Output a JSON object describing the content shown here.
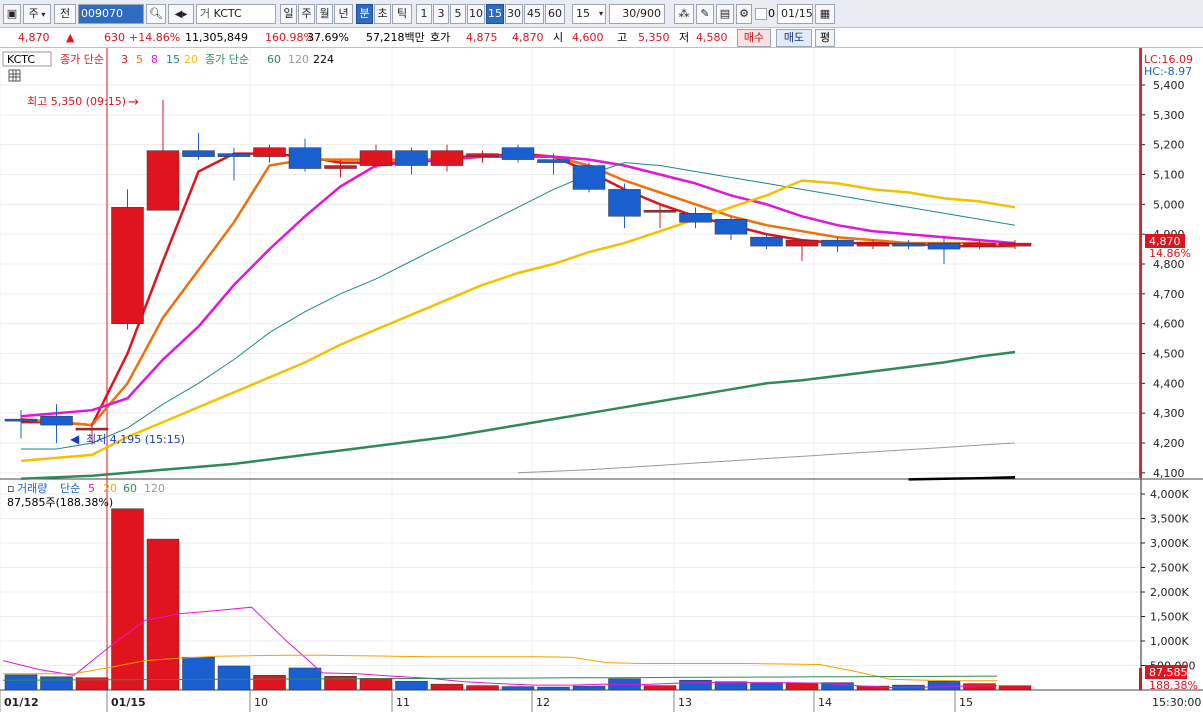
{
  "toolbar": {
    "market_label": "주",
    "all_label": "전",
    "stock_code": "009070",
    "stock_name": "KCTC",
    "period_day": "일",
    "period_week": "주",
    "period_month": "월",
    "period_year": "년",
    "period_minute": "분",
    "period_second": "초",
    "period_tick": "틱",
    "intervals": [
      "1",
      "3",
      "5",
      "10",
      "15",
      "30",
      "45",
      "60"
    ],
    "selected_interval": "15",
    "interval_select_value": "15",
    "count_display": "30/900",
    "checkbox_value": "0",
    "date_value": "01/15"
  },
  "quote": {
    "price": "4,870",
    "arrow": "▲",
    "change": "630",
    "change_pct": "+14.86%",
    "volume": "11,305,849",
    "volume_ratio": "160.98%",
    "turnover": "37.69%",
    "trade_value": "57,218백만",
    "ask_label": "호가",
    "ask_price": "4,875",
    "bid_price": "4,870",
    "open_label": "시",
    "open_value": "4,600",
    "high_label": "고",
    "high_value": "5,350",
    "low_label": "저",
    "low_value": "4,580",
    "buy_label": "매수",
    "sell_label": "매도",
    "avg_label": "평"
  },
  "colors": {
    "up": "#e0141e",
    "down": "#1a5fcf",
    "ma3": "#e0141e",
    "ma5": "#f06f0a",
    "ma8": "#e614d8",
    "ma15": "#1a8a8a",
    "ma20": "#f5c000",
    "ma60": "#2e8b57",
    "ma120": "#999999",
    "ma224": "#000000"
  },
  "price_panel": {
    "symbol": "KCTC",
    "legend_group1_label": "종가 단순",
    "legend_group1_periods": [
      "3",
      "5",
      "8",
      "15",
      "20"
    ],
    "legend_group2_label": "종가 단순",
    "legend_group2_periods": [
      "60",
      "120",
      "224"
    ],
    "lc_label": "LC:16.09",
    "hc_label": "HC:-8.97",
    "high_annotation": "최고 5,350 (09:15)",
    "low_annotation": "최저 4,195 (15:15)",
    "current_price_tag": "4,870",
    "current_pct_tag": "14.86%",
    "y_ticks": [
      "5,400",
      "5,300",
      "5,200",
      "5,100",
      "5,000",
      "4,900",
      "4,800",
      "4,700",
      "4,600",
      "4,500",
      "4,400",
      "4,300",
      "4,200",
      "4,100"
    ]
  },
  "volume_panel": {
    "legend_label": "거래량",
    "legend_ma_label": "단순",
    "legend_periods": [
      "5",
      "20",
      "60",
      "120"
    ],
    "current_volume": "87,585주(188.38%)",
    "y_ticks": [
      "4,000K",
      "3,500K",
      "3,000K",
      "2,500K",
      "2,000K",
      "1,500K",
      "1,000K",
      "500,000"
    ],
    "current_tag": "87,585",
    "current_pct_tag": "188.38%"
  },
  "x_axis": {
    "labels": [
      "01/12",
      "01/15",
      "10",
      "11",
      "12",
      "13",
      "14",
      "15"
    ],
    "time_label": "15:30:00"
  },
  "chart_data": {
    "type": "candlestick",
    "interval": "15분",
    "candles": [
      {
        "o": 4280,
        "h": 4310,
        "l": 4215,
        "c": 4275
      },
      {
        "o": 4290,
        "h": 4330,
        "l": 4200,
        "c": 4260
      },
      {
        "o": 4250,
        "h": 4270,
        "l": 4195,
        "c": 4250
      },
      {
        "o": 4600,
        "h": 5050,
        "l": 4580,
        "c": 4990
      },
      {
        "o": 4980,
        "h": 5350,
        "l": 4980,
        "c": 5180
      },
      {
        "o": 5180,
        "h": 5240,
        "l": 5150,
        "c": 5160
      },
      {
        "o": 5170,
        "h": 5190,
        "l": 5080,
        "c": 5160
      },
      {
        "o": 5160,
        "h": 5200,
        "l": 5140,
        "c": 5190
      },
      {
        "o": 5190,
        "h": 5220,
        "l": 5110,
        "c": 5120
      },
      {
        "o": 5120,
        "h": 5150,
        "l": 5090,
        "c": 5130
      },
      {
        "o": 5130,
        "h": 5200,
        "l": 5120,
        "c": 5180
      },
      {
        "o": 5180,
        "h": 5190,
        "l": 5100,
        "c": 5130
      },
      {
        "o": 5130,
        "h": 5200,
        "l": 5110,
        "c": 5180
      },
      {
        "o": 5160,
        "h": 5180,
        "l": 5140,
        "c": 5170
      },
      {
        "o": 5190,
        "h": 5200,
        "l": 5140,
        "c": 5150
      },
      {
        "o": 5150,
        "h": 5170,
        "l": 5100,
        "c": 5140
      },
      {
        "o": 5130,
        "h": 5140,
        "l": 5040,
        "c": 5050
      },
      {
        "o": 5050,
        "h": 5070,
        "l": 4920,
        "c": 4960
      },
      {
        "o": 4980,
        "h": 5000,
        "l": 4920,
        "c": 4980
      },
      {
        "o": 4970,
        "h": 4990,
        "l": 4920,
        "c": 4940
      },
      {
        "o": 4950,
        "h": 4960,
        "l": 4880,
        "c": 4900
      },
      {
        "o": 4890,
        "h": 4900,
        "l": 4850,
        "c": 4860
      },
      {
        "o": 4860,
        "h": 4880,
        "l": 4810,
        "c": 4880
      },
      {
        "o": 4880,
        "h": 4890,
        "l": 4840,
        "c": 4860
      },
      {
        "o": 4860,
        "h": 4880,
        "l": 4850,
        "c": 4870
      },
      {
        "o": 4870,
        "h": 4880,
        "l": 4850,
        "c": 4860
      },
      {
        "o": 4870,
        "h": 4890,
        "l": 4800,
        "c": 4850
      },
      {
        "o": 4860,
        "h": 4880,
        "l": 4850,
        "c": 4870
      },
      {
        "o": 4860,
        "h": 4880,
        "l": 4850,
        "c": 4870
      }
    ],
    "moving_averages": [
      {
        "name": "3",
        "values": [
          4270,
          4270,
          4260,
          4500,
          4810,
          5110,
          5170,
          5170,
          5160,
          5140,
          5140,
          5140,
          5160,
          5160,
          5170,
          5160,
          5110,
          5050,
          5000,
          4960,
          4930,
          4900,
          4880,
          4870,
          4870,
          4870,
          4860,
          4860,
          4860
        ]
      },
      {
        "name": "5",
        "values": [
          4280,
          4270,
          4260,
          4400,
          4620,
          4780,
          4940,
          5130,
          5150,
          5150,
          5150,
          5150,
          5150,
          5160,
          5160,
          5160,
          5130,
          5080,
          5040,
          5000,
          4960,
          4930,
          4910,
          4890,
          4880,
          4870,
          4870,
          4870,
          4860
        ]
      },
      {
        "name": "8",
        "values": [
          4290,
          4300,
          4310,
          4350,
          4480,
          4590,
          4730,
          4850,
          4960,
          5060,
          5130,
          5140,
          5150,
          5160,
          5160,
          5160,
          5150,
          5130,
          5100,
          5070,
          5030,
          5000,
          4960,
          4930,
          4910,
          4900,
          4890,
          4880,
          4870
        ]
      },
      {
        "name": "15",
        "values": [
          4180,
          4180,
          4200,
          4250,
          4330,
          4400,
          4480,
          4570,
          4640,
          4700,
          4750,
          4810,
          4870,
          4930,
          4990,
          5050,
          5100,
          5140,
          5130,
          5110,
          5090,
          5070,
          5050,
          5030,
          5010,
          4990,
          4970,
          4950,
          4930
        ]
      },
      {
        "name": "20",
        "values": [
          4140,
          4150,
          4160,
          4220,
          4270,
          4320,
          4370,
          4420,
          4470,
          4530,
          4580,
          4630,
          4680,
          4730,
          4770,
          4800,
          4840,
          4870,
          4910,
          4950,
          4990,
          5030,
          5080,
          5070,
          5050,
          5040,
          5020,
          5010,
          4990
        ]
      },
      {
        "name": "60",
        "values": [
          4080,
          4085,
          4090,
          4100,
          4110,
          4120,
          4130,
          4145,
          4160,
          4175,
          4190,
          4205,
          4220,
          4240,
          4260,
          4280,
          4300,
          4320,
          4340,
          4360,
          4380,
          4400,
          4410,
          4425,
          4440,
          4455,
          4470,
          4490,
          4505
        ]
      },
      {
        "name": "120",
        "values": [
          null,
          null,
          null,
          null,
          null,
          null,
          null,
          null,
          null,
          null,
          null,
          null,
          null,
          null,
          4100,
          4105,
          4110,
          4118,
          4125,
          4133,
          4140,
          4148,
          4155,
          4163,
          4170,
          4178,
          4185,
          4193,
          4200
        ]
      },
      {
        "name": "224",
        "values": [
          null,
          null,
          null,
          null,
          null,
          null,
          null,
          null,
          null,
          null,
          null,
          null,
          null,
          null,
          null,
          null,
          null,
          null,
          null,
          null,
          null,
          null,
          null,
          null,
          null,
          4078,
          4080,
          4082,
          4085
        ]
      }
    ],
    "volume": [
      310,
      270,
      250,
      3700,
      3080,
      670,
      490,
      300,
      450,
      280,
      240,
      180,
      120,
      90,
      70,
      60,
      80,
      230,
      90,
      200,
      170,
      150,
      140,
      150,
      80,
      100,
      180,
      130,
      88
    ],
    "volume_ma5": [
      600,
      420,
      300,
      880,
      1420,
      1560,
      1620,
      1690,
      990,
      350,
      330,
      280,
      240,
      170,
      130,
      100,
      100,
      120,
      110,
      140,
      150,
      150,
      150,
      140,
      90,
      50,
      60,
      80,
      90
    ]
  }
}
